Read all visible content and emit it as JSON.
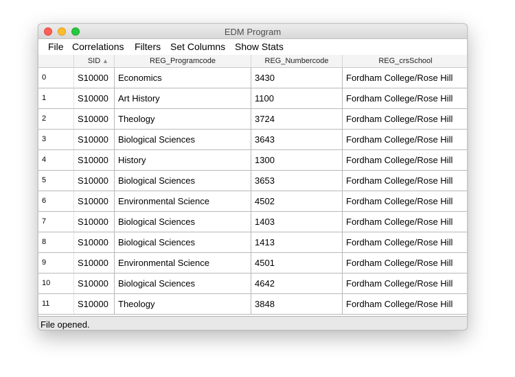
{
  "window": {
    "title": "EDM Program"
  },
  "menu": [
    "File",
    "Correlations",
    "Filters",
    "Set Columns",
    "Show Stats"
  ],
  "table": {
    "columns": [
      "",
      "SID",
      "REG_Programcode",
      "REG_Numbercode",
      "REG_crsSchool"
    ],
    "sort_indicator": "▲",
    "rows": [
      [
        "0",
        "S10000",
        "Economics",
        "3430",
        "Fordham College/Rose Hill"
      ],
      [
        "1",
        "S10000",
        "Art History",
        "1100",
        "Fordham College/Rose Hill"
      ],
      [
        "2",
        "S10000",
        "Theology",
        "3724",
        "Fordham College/Rose Hill"
      ],
      [
        "3",
        "S10000",
        "Biological Sciences",
        "3643",
        "Fordham College/Rose Hill"
      ],
      [
        "4",
        "S10000",
        "History",
        "1300",
        "Fordham College/Rose Hill"
      ],
      [
        "5",
        "S10000",
        "Biological Sciences",
        "3653",
        "Fordham College/Rose Hill"
      ],
      [
        "6",
        "S10000",
        "Environmental Science",
        "4502",
        "Fordham College/Rose Hill"
      ],
      [
        "7",
        "S10000",
        "Biological Sciences",
        "1403",
        "Fordham College/Rose Hill"
      ],
      [
        "8",
        "S10000",
        "Biological Sciences",
        "1413",
        "Fordham College/Rose Hill"
      ],
      [
        "9",
        "S10000",
        "Environmental Science",
        "4501",
        "Fordham College/Rose Hill"
      ],
      [
        "10",
        "S10000",
        "Biological Sciences",
        "4642",
        "Fordham College/Rose Hill"
      ],
      [
        "11",
        "S10000",
        "Theology",
        "3848",
        "Fordham College/Rose Hill"
      ]
    ]
  },
  "status": {
    "text": "File opened."
  },
  "colors": {
    "close": "#fe5f57",
    "minimize": "#febc2e",
    "zoom": "#28c840"
  }
}
